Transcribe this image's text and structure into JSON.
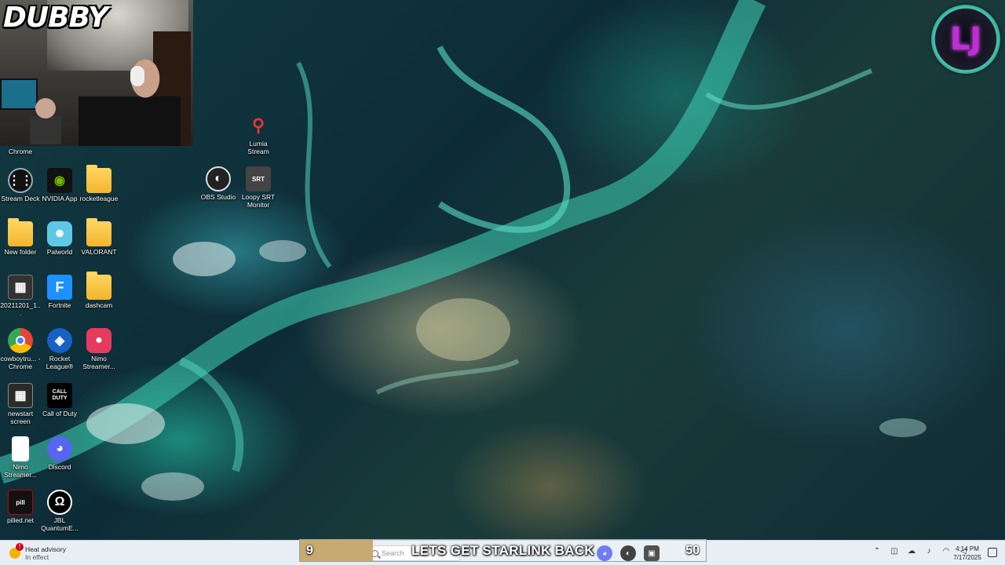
{
  "webcam": {
    "streamer_name": "DUBBY"
  },
  "logo": {
    "text": "LJ"
  },
  "desktop_icons": [
    {
      "id": "chrome-top",
      "label": "Chrome",
      "icon": "chrome-icon"
    },
    {
      "id": "stream-deck",
      "label": "Stream Deck",
      "icon": "stream-deck-icon"
    },
    {
      "id": "nvidia",
      "label": "NVIDIA App",
      "icon": "nvidia-icon"
    },
    {
      "id": "rocketleague-folder",
      "label": "rocketleague",
      "icon": "folder-icon"
    },
    {
      "id": "new-folder",
      "label": "New folder",
      "icon": "folder-icon"
    },
    {
      "id": "palworld",
      "label": "Palworld",
      "icon": "palworld-icon"
    },
    {
      "id": "valorant-folder",
      "label": "VALORANT",
      "icon": "folder-icon"
    },
    {
      "id": "screenshot-2021",
      "label": "20211201_1...",
      "icon": "image-file-icon"
    },
    {
      "id": "fortnite",
      "label": "Fortnite",
      "icon": "fortnite-icon"
    },
    {
      "id": "dashcam-folder",
      "label": "dashcam",
      "icon": "folder-icon"
    },
    {
      "id": "cowboytru-chrome",
      "label": "cowboytru... - Chrome",
      "icon": "chrome-icon"
    },
    {
      "id": "rocket-league",
      "label": "Rocket League®",
      "icon": "rocket-league-icon"
    },
    {
      "id": "nimo-streamer-1",
      "label": "Nimo Streamer...",
      "icon": "nimo-icon"
    },
    {
      "id": "newstart-screen",
      "label": "newstart screen",
      "icon": "image-file-icon"
    },
    {
      "id": "call-of-duty",
      "label": "Call of Duty",
      "icon": "call-of-duty-icon"
    },
    {
      "id": "nimo-streamer-2",
      "label": "Nimo Streamer...",
      "icon": "file-icon"
    },
    {
      "id": "discord",
      "label": "Discord",
      "icon": "discord-icon"
    },
    {
      "id": "pilled-net",
      "label": "pilled.net",
      "icon": "pilled-icon"
    },
    {
      "id": "jbl-quantum",
      "label": "JBL QuantumE...",
      "icon": "jbl-icon"
    },
    {
      "id": "lumia-stream",
      "label": "Lumia Stream",
      "icon": "lumia-icon"
    },
    {
      "id": "obs-studio",
      "label": "OBS Studio",
      "icon": "obs-icon"
    },
    {
      "id": "loopy-srt",
      "label": "Loopy SRT Monitor",
      "icon": "srt-icon"
    }
  ],
  "taskbar": {
    "weather_title": "Heat advisory",
    "weather_sub": "In effect",
    "search_placeholder": "Search",
    "time": "4:14 PM",
    "date": "7/17/2025"
  },
  "goal": {
    "current": "9",
    "title": "LETS GET STARLINK BACK",
    "target": "50",
    "progress_fraction": 0.18
  },
  "colors": {
    "goal_fill": "#c8a970",
    "logo_accent": "#c22bd8",
    "taskbar_bg": "#e8eef3"
  }
}
